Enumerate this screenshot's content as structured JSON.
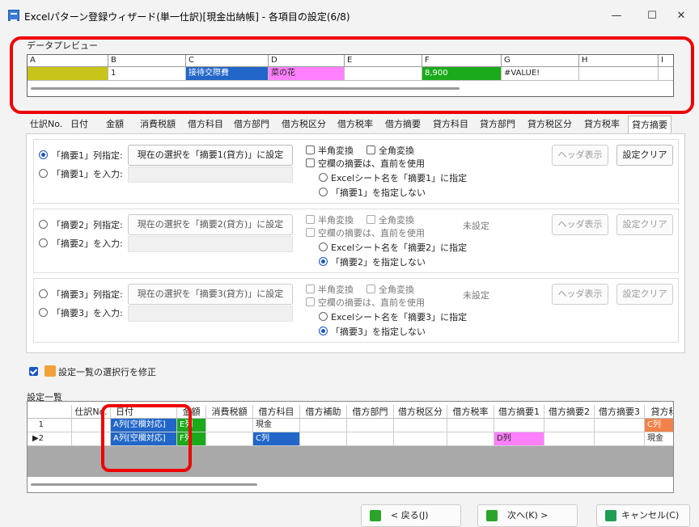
{
  "window": {
    "title": "Excelパターン登録ウィザード(単一仕訳)[現金出納帳] - 各項目の設定(6/8)",
    "minimize": "—",
    "maximize": "☐",
    "close": "✕"
  },
  "preview": {
    "label": "データプレビュー",
    "columns": [
      "A",
      "B",
      "C",
      "D",
      "E",
      "F",
      "G",
      "H",
      "I"
    ],
    "cells": [
      {
        "text": "",
        "color": "#c8c41a"
      },
      {
        "text": "1",
        "color": "#ffffff"
      },
      {
        "text": "接待交際費",
        "color": "#2166c8"
      },
      {
        "text": "菜の花",
        "color": "#ff80ff"
      },
      {
        "text": "",
        "color": "#ffffff"
      },
      {
        "text": "8,900",
        "color": "#1aaa1a"
      },
      {
        "text": "#VALUE!",
        "color": "#ffffff"
      },
      {
        "text": "",
        "color": "#ffffff"
      },
      {
        "text": "",
        "color": "#ffffff"
      }
    ]
  },
  "tabs": [
    "仕訳No.",
    "日付",
    "金額",
    "消費税額",
    "借方科目",
    "借方部門",
    "借方税区分",
    "借方税率",
    "借方摘要",
    "貸方科目",
    "貸方部門",
    "貸方税区分",
    "貸方税率",
    "貸方摘要"
  ],
  "active_tab": "貸方摘要",
  "groups": [
    {
      "col_label": "「摘要1」列指定:",
      "input_label": "「摘要1」を入力:",
      "set_button": "現在の選択を「摘要1(貸方)」に設定",
      "hankaku": "半角変換",
      "zenkaku": "全角変換",
      "prev": "空欄の摘要は、直前を使用",
      "sheet_name": "Excelシート名を「摘要1」に指定",
      "none": "「摘要1」を指定しない",
      "status": "",
      "header_btn": "ヘッダ表示",
      "clear_btn": "設定クリア"
    },
    {
      "col_label": "「摘要2」列指定:",
      "input_label": "「摘要2」を入力:",
      "set_button": "現在の選択を「摘要2(貸方)」に設定",
      "hankaku": "半角変換",
      "zenkaku": "全角変換",
      "prev": "空欄の摘要は、直前を使用",
      "sheet_name": "Excelシート名を「摘要2」に指定",
      "none": "「摘要2」を指定しない",
      "status": "未設定",
      "header_btn": "ヘッダ表示",
      "clear_btn": "設定クリア"
    },
    {
      "col_label": "「摘要3」列指定:",
      "input_label": "「摘要3」を入力:",
      "set_button": "現在の選択を「摘要3(貸方)」に設定",
      "hankaku": "半角変換",
      "zenkaku": "全角変換",
      "prev": "空欄の摘要は、直前を使用",
      "sheet_name": "Excelシート名を「摘要3」に指定",
      "none": "「摘要3」を指定しない",
      "status": "未設定",
      "header_btn": "ヘッダ表示",
      "clear_btn": "設定クリア"
    }
  ],
  "modify_checkbox": "設定一覧の選択行を修正",
  "settings_list": {
    "label": "設定一覧",
    "headers": [
      "仕訳No.",
      "日付",
      "金額",
      "消費税額",
      "借方科目",
      "借方補助",
      "借方部門",
      "借方税区分",
      "借方税率",
      "借方摘要1",
      "借方摘要2",
      "借方摘要3",
      "貸方科目"
    ],
    "rows": [
      {
        "num": "1",
        "marker": "",
        "date": "A列[空欄対応]",
        "amount": "E列",
        "debit_account": "現金",
        "debit_memo1": "",
        "credit_account": "C列"
      },
      {
        "num": "2",
        "marker": "▶",
        "date": "A列[空欄対応]",
        "amount": "F列",
        "debit_account": "C列",
        "debit_memo1": "D列",
        "credit_account": "現金"
      }
    ]
  },
  "nav": {
    "back": "< 戻る(J)",
    "next": "次へ(K) >",
    "cancel": "キャンセル(C)"
  },
  "colors": {
    "highlight": "#e00000",
    "blue": "#2166c8",
    "green": "#1aaa1a",
    "orange": "#f0824a",
    "magenta": "#ff80ff"
  }
}
